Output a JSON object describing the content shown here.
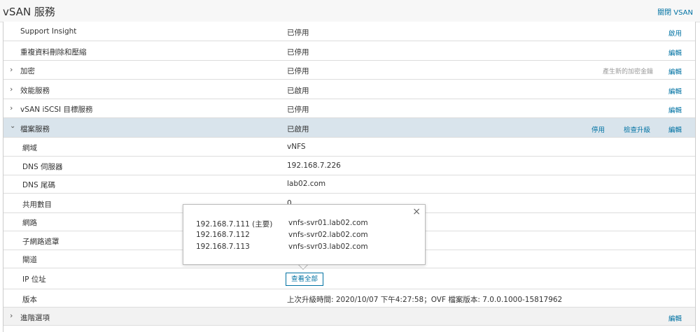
{
  "header": {
    "title": "vSAN 服務",
    "close_label": "關閉 VSAN"
  },
  "icons": {
    "expand": "chevron-right-icon",
    "collapse": "chevron-down-icon",
    "close": "close-icon"
  },
  "rows": {
    "support_insight": {
      "name": "Support Insight",
      "value": "已停用",
      "action": "啟用"
    },
    "dedup": {
      "name": "重複資料刪除和壓縮",
      "value": "已停用",
      "action": "編輯"
    },
    "encryption": {
      "name": "加密",
      "value": "已停用",
      "hint": "產生新的加密金鑰",
      "action": "編輯"
    },
    "performance": {
      "name": "效能服務",
      "value": "已啟用",
      "action": "編輯"
    },
    "iscsi": {
      "name": "vSAN iSCSI 目標服務",
      "value": "已停用",
      "action": "編輯"
    },
    "file_service": {
      "name": "檔案服務",
      "value": "已啟用",
      "action_disable": "停用",
      "action_upgrade": "檢查升級",
      "action": "編輯"
    },
    "domain": {
      "name": "網域",
      "value": "vNFS"
    },
    "dns_server": {
      "name": "DNS 伺服器",
      "value": "192.168.7.226"
    },
    "dns_suffix": {
      "name": "DNS 尾碼",
      "value": "lab02.com"
    },
    "share_count": {
      "name": "共用數目",
      "value": "0"
    },
    "network": {
      "name": "網路"
    },
    "subnet": {
      "name": "子網路遮罩"
    },
    "gateway": {
      "name": "閘道"
    },
    "ip_address": {
      "name": "IP 位址",
      "button": "查看全部"
    },
    "version": {
      "name": "版本",
      "value": "上次升級時間: 2020/10/07 下午4:27:58；OVF 檔案版本: 7.0.0.1000-15817962"
    },
    "advanced": {
      "name": "進階選項",
      "action": "編輯"
    }
  },
  "popover": {
    "entries": [
      {
        "ip": "192.168.7.111 (主要)",
        "host": "vnfs-svr01.lab02.com"
      },
      {
        "ip": "192.168.7.112",
        "host": "vnfs-svr02.lab02.com"
      },
      {
        "ip": "192.168.7.113",
        "host": "vnfs-svr03.lab02.com"
      }
    ]
  },
  "colors": {
    "link": "#0072a3",
    "active_row": "#d9e4ec",
    "grey_row": "#f2f2f2"
  }
}
